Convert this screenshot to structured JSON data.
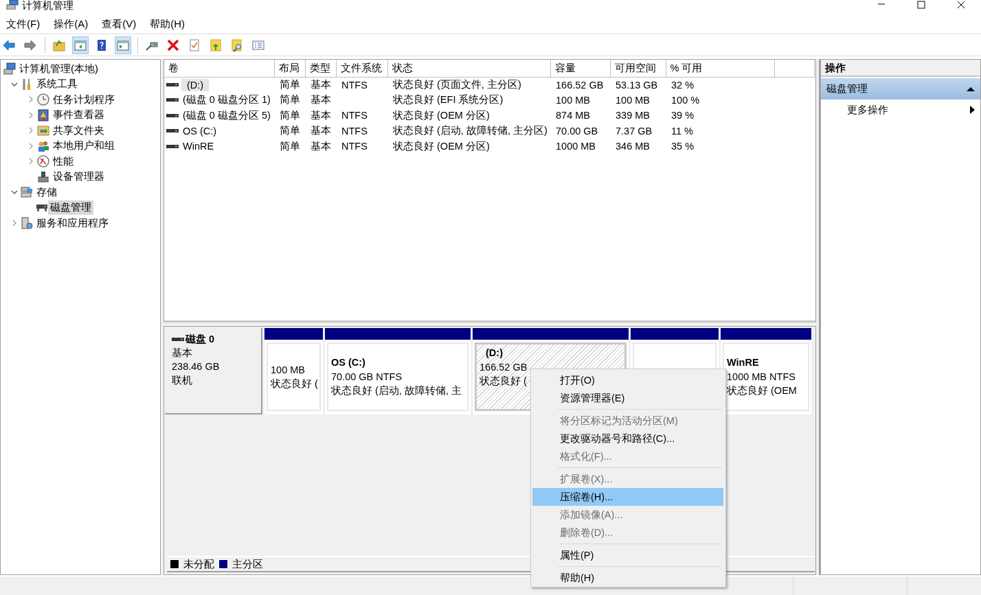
{
  "window": {
    "title": "计算机管理"
  },
  "menu_bar": [
    "文件(F)",
    "操作(A)",
    "查看(V)",
    "帮助(H)"
  ],
  "toolbar": {
    "groups": [
      [
        {
          "kind": "back",
          "pressed": false
        },
        {
          "kind": "forward",
          "pressed": false
        }
      ],
      [
        {
          "kind": "up-folder",
          "pressed": false
        },
        {
          "kind": "tree-pane",
          "pressed": true
        },
        {
          "kind": "help",
          "pressed": false
        },
        {
          "kind": "action-pane",
          "pressed": true
        }
      ],
      [
        {
          "kind": "connect",
          "pressed": false
        },
        {
          "kind": "delete",
          "pressed": false
        },
        {
          "kind": "check",
          "pressed": false
        },
        {
          "kind": "export",
          "pressed": false
        },
        {
          "kind": "find",
          "pressed": false
        },
        {
          "kind": "list",
          "pressed": false
        }
      ]
    ]
  },
  "tree": {
    "label": "计算机管理(本地)",
    "kind": "computer",
    "selected": false,
    "children": [
      {
        "label": "系统工具",
        "kind": "tools",
        "expanded": true,
        "selected": false,
        "children": [
          {
            "label": "任务计划程序",
            "kind": "clock",
            "expanded": false,
            "selected": false
          },
          {
            "label": "事件查看器",
            "kind": "eventlog",
            "expanded": false,
            "selected": false
          },
          {
            "label": "共享文件夹",
            "kind": "share",
            "expanded": false,
            "selected": false
          },
          {
            "label": "本地用户和组",
            "kind": "users",
            "expanded": false,
            "selected": false
          },
          {
            "label": "性能",
            "kind": "perf",
            "expanded": false,
            "selected": false
          },
          {
            "label": "设备管理器",
            "kind": "device",
            "selected": false
          }
        ]
      },
      {
        "label": "存储",
        "kind": "storage",
        "expanded": true,
        "selected": false,
        "children": [
          {
            "label": "磁盘管理",
            "kind": "disk",
            "selected": true
          }
        ]
      },
      {
        "label": "服务和应用程序",
        "kind": "services",
        "expanded": false,
        "selected": false
      }
    ]
  },
  "volume_table": {
    "columns": [
      "卷",
      "布局",
      "类型",
      "文件系统",
      "状态",
      "容量",
      "可用空间",
      "% 可用"
    ],
    "rows": [
      {
        "selected": true,
        "cells": [
          "(D:)",
          "简单",
          "基本",
          "NTFS",
          "状态良好 (页面文件, 主分区)",
          "166.52 GB",
          "53.13 GB",
          "32 %"
        ]
      },
      {
        "selected": false,
        "cells": [
          "(磁盘 0 磁盘分区 1)",
          "简单",
          "基本",
          "",
          "状态良好 (EFI 系统分区)",
          "100 MB",
          "100 MB",
          "100 %"
        ]
      },
      {
        "selected": false,
        "cells": [
          "(磁盘 0 磁盘分区 5)",
          "简单",
          "基本",
          "NTFS",
          "状态良好 (OEM 分区)",
          "874 MB",
          "339 MB",
          "39 %"
        ]
      },
      {
        "selected": false,
        "cells": [
          "OS (C:)",
          "简单",
          "基本",
          "NTFS",
          "状态良好 (启动, 故障转储, 主分区)",
          "70.00 GB",
          "7.37 GB",
          "11 %"
        ]
      },
      {
        "selected": false,
        "cells": [
          "WinRE",
          "简单",
          "基本",
          "NTFS",
          "状态良好 (OEM 分区)",
          "1000 MB",
          "346 MB",
          "35 %"
        ]
      }
    ]
  },
  "disk_map": {
    "disks": [
      {
        "name": "磁盘 0",
        "type": "基本",
        "size": "238.46 GB",
        "status": "联机",
        "partitions": [
          {
            "selected": false,
            "detail": "100 MB",
            "status": "状态良好 ("
          },
          {
            "selected": false,
            "name": "OS  (C:)",
            "detail": "70.00 GB NTFS",
            "status": "状态良好 (启动, 故障转储, 主"
          },
          {
            "selected": true,
            "name": "(D:)",
            "detail": "166.52 GB",
            "status": "状态良好 ("
          },
          {
            "selected": false
          },
          {
            "selected": false,
            "name": "WinRE",
            "detail": "1000 MB NTFS",
            "status": "状态良好 (OEM"
          }
        ]
      }
    ],
    "legend": [
      {
        "label": "未分配",
        "color": "#000000"
      },
      {
        "label": "主分区",
        "color": "#000080"
      }
    ]
  },
  "actions": {
    "title": "操作",
    "groups": [
      {
        "label": "磁盘管理",
        "expanded": true,
        "items": [
          "更多操作"
        ]
      }
    ]
  },
  "context_menu": {
    "items": [
      {
        "kind": "item",
        "label": "打开(O)",
        "disabled": false,
        "selected": false
      },
      {
        "kind": "item",
        "label": "资源管理器(E)",
        "disabled": false,
        "selected": false
      },
      {
        "kind": "separator"
      },
      {
        "kind": "item",
        "label": "将分区标记为活动分区(M)",
        "disabled": true,
        "selected": false
      },
      {
        "kind": "item",
        "label": "更改驱动器号和路径(C)...",
        "disabled": false,
        "selected": false
      },
      {
        "kind": "item",
        "label": "格式化(F)...",
        "disabled": true,
        "selected": false
      },
      {
        "kind": "separator"
      },
      {
        "kind": "item",
        "label": "扩展卷(X)...",
        "disabled": true,
        "selected": false
      },
      {
        "kind": "item",
        "label": "压缩卷(H)...",
        "disabled": false,
        "selected": true
      },
      {
        "kind": "item",
        "label": "添加镜像(A)...",
        "disabled": true,
        "selected": false
      },
      {
        "kind": "item",
        "label": "删除卷(D)...",
        "disabled": true,
        "selected": false
      },
      {
        "kind": "separator"
      },
      {
        "kind": "item",
        "label": "属性(P)",
        "disabled": false,
        "selected": false
      },
      {
        "kind": "separator"
      },
      {
        "kind": "item",
        "label": "帮助(H)",
        "disabled": false,
        "selected": false
      }
    ]
  }
}
